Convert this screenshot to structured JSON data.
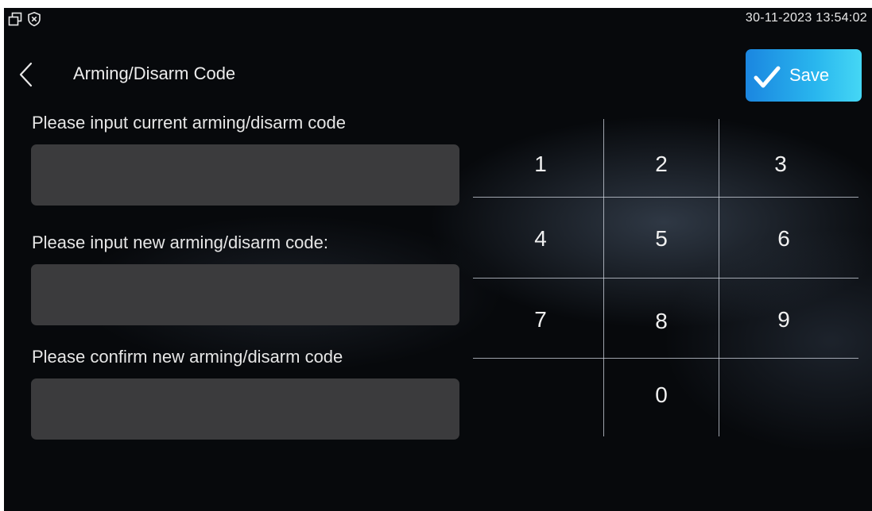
{
  "status_bar": {
    "icons": [
      "window-restore-icon",
      "shield-x-icon"
    ],
    "datetime": "30-11-2023 13:54:02"
  },
  "header": {
    "back_icon": "chevron-left-icon",
    "title": "Arming/Disarm Code",
    "save_label": "Save",
    "save_icon": "checkmark-icon"
  },
  "form": {
    "fields": [
      {
        "label": "Please input current arming/disarm code",
        "value": ""
      },
      {
        "label": "Please input new arming/disarm code:",
        "value": ""
      },
      {
        "label": "Please confirm new arming/disarm code",
        "value": ""
      }
    ]
  },
  "keypad": {
    "keys": [
      "1",
      "2",
      "3",
      "4",
      "5",
      "6",
      "7",
      "8",
      "9",
      "0"
    ]
  },
  "colors": {
    "background": "#07090c",
    "input_bg": "#3b3b3d",
    "save_gradient_start": "#1b86e0",
    "save_gradient_end": "#45d7f5"
  }
}
